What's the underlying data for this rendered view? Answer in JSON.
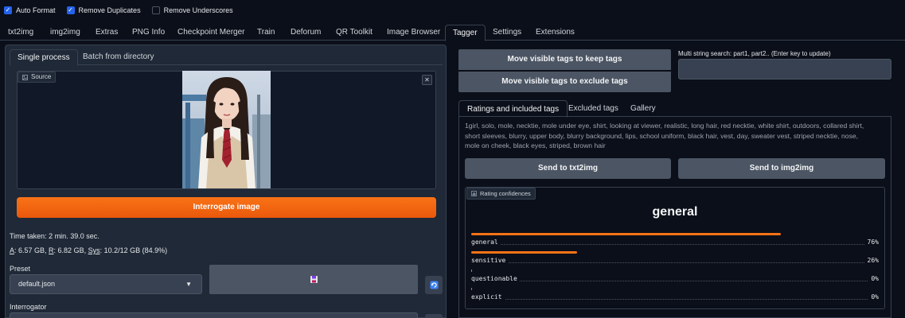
{
  "topbar": {
    "checkboxes": [
      {
        "label": "Auto Format",
        "checked": true
      },
      {
        "label": "Remove Duplicates",
        "checked": true
      },
      {
        "label": "Remove Underscores",
        "checked": false
      }
    ]
  },
  "main_tabs": [
    "txt2img",
    "img2img",
    "Extras",
    "PNG Info",
    "Checkpoint Merger",
    "Train",
    "Deforum",
    "QR Toolkit",
    "Image Browser",
    "Tagger",
    "Settings",
    "Extensions"
  ],
  "main_tab_active": "Tagger",
  "left": {
    "subtabs": [
      "Single process",
      "Batch from directory"
    ],
    "source_label": "Source",
    "close_glyph": "✕",
    "interrogate_label": "Interrogate image",
    "time_taken": "Time taken: 2 min. 39.0 sec.",
    "mem": {
      "a_key": "A",
      "a_val": ": 6.57 GB, ",
      "r_key": "R",
      "r_val": ": 6.82 GB, ",
      "sys_key": "Sys",
      "sys_val": ": 10.2/12 GB (84.9%)"
    },
    "preset_label": "Preset",
    "preset_value": "default.json",
    "interrogator_label": "Interrogator"
  },
  "right": {
    "keep_label": "Move visible tags to keep tags",
    "exclude_label": "Move visible tags to exclude tags",
    "search_label": "Multi string search: part1, part2.. (Enter key to update)",
    "tabs": [
      "Ratings and included tags",
      "Excluded tags",
      "Gallery"
    ],
    "tags": [
      "1girl",
      "solo",
      "mole",
      "necktie",
      "mole under eye",
      "shirt",
      "looking at viewer",
      "realistic",
      "long hair",
      "red necktie",
      "white shirt",
      "outdoors",
      "collared shirt",
      "short sleeves",
      "blurry",
      "upper body",
      "blurry background",
      "lips",
      "school uniform",
      "black hair",
      "vest",
      "day",
      "sweater vest",
      "striped necktie",
      "nose",
      "mole on cheek",
      "black eyes",
      "striped",
      "brown hair"
    ],
    "send_txt2img": "Send to txt2img",
    "send_img2img": "Send to img2img",
    "rating_label": "Rating confidences",
    "rating_title": "general",
    "confidences": [
      {
        "name": "general",
        "pct": "76%",
        "value": 0.76
      },
      {
        "name": "sensitive",
        "pct": "26%",
        "value": 0.26
      },
      {
        "name": "questionable",
        "pct": "0%",
        "value": 0.0
      },
      {
        "name": "explicit",
        "pct": "0%",
        "value": 0.0
      }
    ]
  },
  "colors": {
    "accent": "#f97316",
    "checkbox": "#2563eb",
    "bg": "#0b0f19",
    "panel": "#1f2937"
  }
}
